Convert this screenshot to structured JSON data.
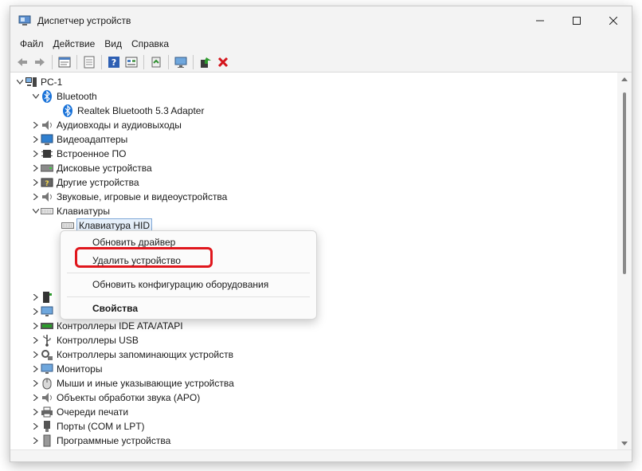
{
  "window": {
    "title": "Диспетчер устройств",
    "icon": "device-manager-icon"
  },
  "menu": [
    "Файл",
    "Действие",
    "Вид",
    "Справка"
  ],
  "toolbar": [
    "back-icon",
    "forward-icon",
    "properties-icon",
    "update-icon",
    "help-icon",
    "view-icon",
    "scan-icon",
    "monitor-icon",
    "enable-icon",
    "delete-icon"
  ],
  "tree": {
    "root": "PC-1",
    "items": [
      {
        "label": "Bluetooth",
        "icon": "bluetooth-icon",
        "expanded": true,
        "level": 1
      },
      {
        "label": "Realtek Bluetooth 5.3 Adapter",
        "icon": "bluetooth-icon",
        "level": 2
      },
      {
        "label": "Аудиовходы и аудиовыходы",
        "icon": "speaker-icon",
        "level": 1
      },
      {
        "label": "Видеоадаптеры",
        "icon": "display-adapter-icon",
        "level": 1
      },
      {
        "label": "Встроенное ПО",
        "icon": "firmware-icon",
        "level": 1
      },
      {
        "label": "Дисковые устройства",
        "icon": "disk-icon",
        "level": 1
      },
      {
        "label": "Другие устройства",
        "icon": "other-device-icon",
        "level": 1
      },
      {
        "label": "Звуковые, игровые и видеоустройства",
        "icon": "speaker-icon",
        "level": 1
      },
      {
        "label": "Клавиатуры",
        "icon": "keyboard-icon",
        "expanded": true,
        "level": 1
      },
      {
        "label": "Клавиатура HID",
        "icon": "keyboard-icon",
        "level": 2,
        "selected": true
      },
      {
        "label": "Контроллеры IDE ATA/ATAPI",
        "icon": "ide-controller-icon",
        "level": 1
      },
      {
        "label": "Контроллеры USB",
        "icon": "usb-icon",
        "level": 1
      },
      {
        "label": "Контроллеры запоминающих устройств",
        "icon": "storage-controller-icon",
        "level": 1
      },
      {
        "label": "Мониторы",
        "icon": "monitor-icon",
        "level": 1
      },
      {
        "label": "Мыши и иные указывающие устройства",
        "icon": "mouse-icon",
        "level": 1
      },
      {
        "label": "Объекты обработки звука (APO)",
        "icon": "speaker-icon",
        "level": 1
      },
      {
        "label": "Очереди печати",
        "icon": "printer-icon",
        "level": 1
      },
      {
        "label": "Порты (COM и LPT)",
        "icon": "port-icon",
        "level": 1
      },
      {
        "label": "Программные устройства",
        "icon": "software-device-icon",
        "level": 1
      }
    ]
  },
  "context_menu": {
    "items": [
      {
        "label": "Обновить драйвер"
      },
      {
        "label": "Удалить устройство",
        "highlighted": true
      },
      {
        "label": "Обновить конфигурацию оборудования"
      },
      {
        "label": "Свойства",
        "bold": true
      }
    ],
    "highlight_color": "#e0171d"
  },
  "colors": {
    "bluetooth": "#1a73d9",
    "delete": "#d4141b",
    "selection_border": "#7fa8d8"
  }
}
